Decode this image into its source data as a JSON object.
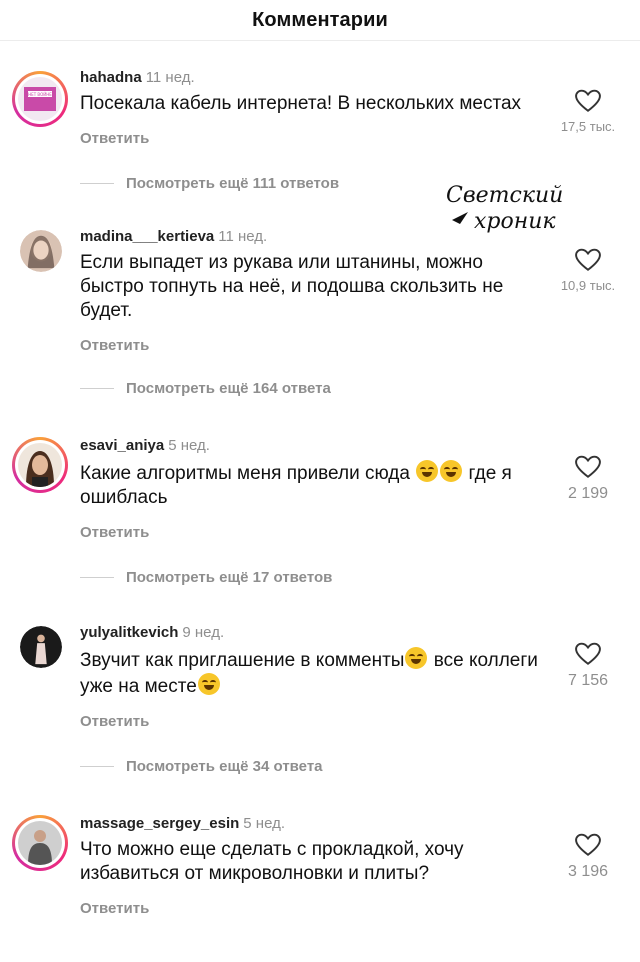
{
  "header": {
    "title": "Комментарии"
  },
  "watermark": {
    "line1": "Светский",
    "line2": "хроник"
  },
  "comments": [
    {
      "username": "hahadna",
      "age": "11 нед.",
      "text": "Посекала кабель интернета! В нескольких местах",
      "reply": "Ответить",
      "likes": "17,5 тыс.",
      "replies": "Посмотреть ещё 111 ответов",
      "avatar_label": "НЕТ ВОЙНЕ"
    },
    {
      "username": "madina___kertieva",
      "age": "11 нед.",
      "text": "Если выпадет из рукава или штанины, можно быстро топнуть на неё, и подошва скользить не будет.",
      "reply": "Ответить",
      "likes": "10,9 тыс.",
      "replies": "Посмотреть ещё 164 ответа"
    },
    {
      "username": "esavi_aniya",
      "age": "5 нед.",
      "text_before": "Какие алгоритмы меня привели сюда",
      "text_after": "где я ошиблась",
      "reply": "Ответить",
      "likes": "2 199",
      "replies": "Посмотреть ещё 17 ответов"
    },
    {
      "username": "yulyalitkevich",
      "age": "9 нед.",
      "text_before": "Звучит как приглашение в комменты",
      "text_mid": "все коллеги уже на месте",
      "reply": "Ответить",
      "likes": "7 156",
      "replies": "Посмотреть ещё 34 ответа"
    },
    {
      "username": "massage_sergey_esin",
      "age": "5 нед.",
      "text": "Что можно еще сделать с прокладкой, хочу избавиться от микроволновки и плиты?",
      "reply": "Ответить",
      "likes": "3 196"
    }
  ],
  "colors": {
    "secondary_text": "#8e8e8e",
    "story_ring": "#ee2a7b",
    "emoji": "#f7c62a"
  },
  "icons": {
    "like": "heart-outline-icon",
    "emoji": "rolling-laughing-emoji"
  }
}
